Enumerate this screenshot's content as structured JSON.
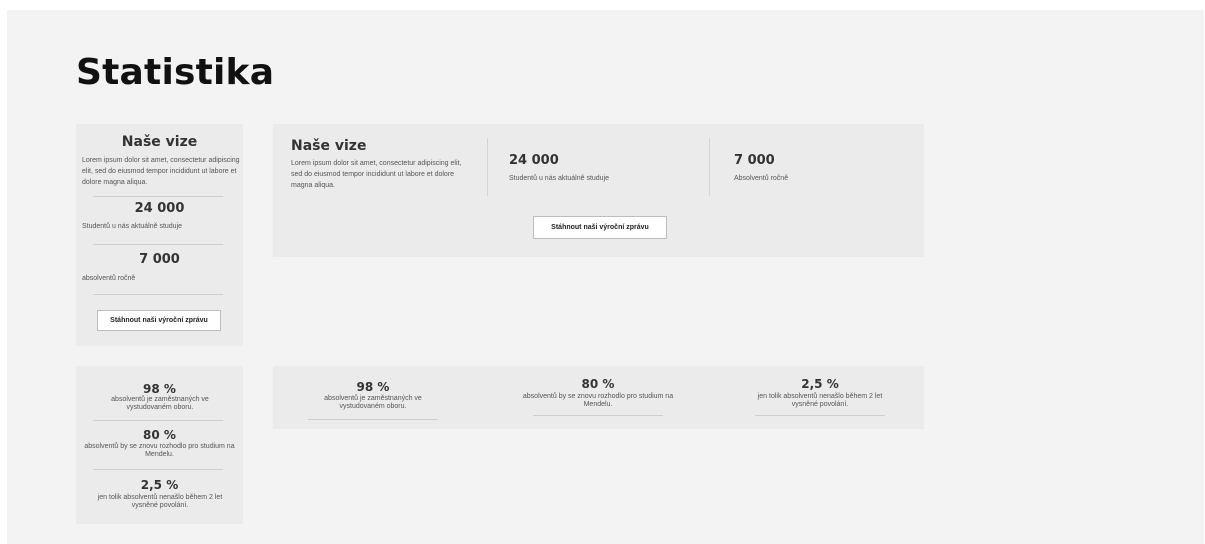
{
  "page": {
    "title": "Statistika"
  },
  "vision": {
    "heading": "Naše vize",
    "text": "Lorem ipsum dolor sit amet, consectetur adipiscing elit, sed do eiusmod tempor incididunt ut labore et dolore magna aliqua."
  },
  "mobile_stats": {
    "students_value": "24 000",
    "students_label": "Studentů u nás aktuálně studuje",
    "graduates_value": "7 000",
    "graduates_label": "absolventů ročně"
  },
  "desktop_stats": {
    "students_value": "24 000",
    "students_label": "Studentů u nás aktuálně studuje",
    "graduates_value": "7 000",
    "graduates_label": "Absolventů ročně"
  },
  "report_button": "Stáhnout naši výroční zprávu",
  "percentages": [
    {
      "value": "98 %",
      "label": "absolventů je zaměstnaných ve vystudovaném oboru."
    },
    {
      "value": "80 %",
      "label": "absolventů by se znovu rozhodlo pro studium na Mendelu."
    },
    {
      "value": "2,5 %",
      "label": "jen tolik absolventů nenašlo během 2 let vysněné povolání."
    }
  ]
}
